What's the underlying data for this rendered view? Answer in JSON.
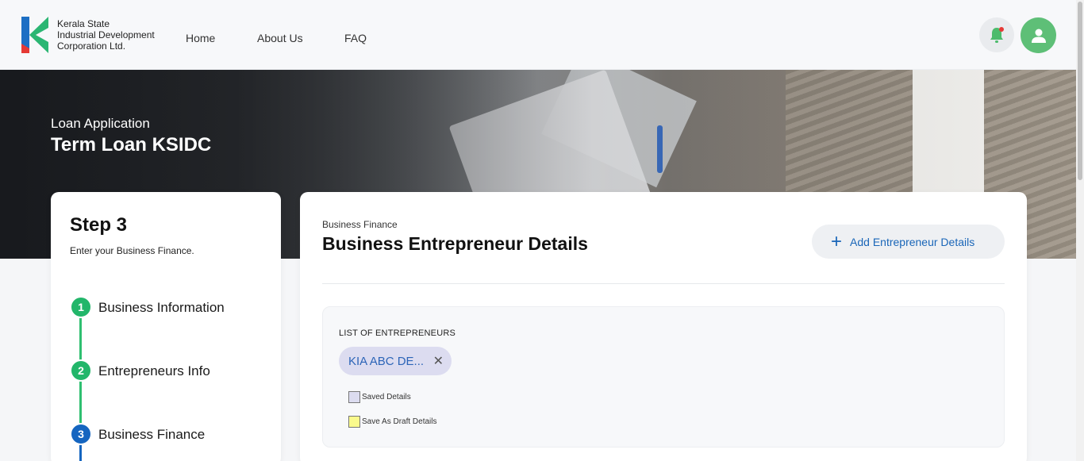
{
  "header": {
    "logo_text": [
      "Kerala State",
      "Industrial Development",
      "Corporation Ltd."
    ],
    "nav": [
      "Home",
      "About Us",
      "FAQ"
    ],
    "notification_icon": "bell-icon",
    "notification_dot_color": "#e53935",
    "profile_icon": "user-icon"
  },
  "hero": {
    "subtitle": "Loan Application",
    "title": "Term Loan KSIDC"
  },
  "steps": {
    "title": "Step 3",
    "description": "Enter your Business Finance.",
    "items": [
      {
        "number": "1",
        "label": "Business Information",
        "status": "complete"
      },
      {
        "number": "2",
        "label": "Entrepreneurs Info",
        "status": "complete"
      },
      {
        "number": "3",
        "label": "Business Finance",
        "status": "current"
      }
    ]
  },
  "main": {
    "kicker": "Business Finance",
    "title": "Business Entrepreneur Details",
    "add_button": "Add Entrepreneur Details",
    "list": {
      "heading": "LIST OF ENTREPRENEURS",
      "chips": [
        "KIA ABC DE..."
      ],
      "legend": [
        {
          "label": "Saved Details",
          "color": "#dcdcf0"
        },
        {
          "label": "Save As Draft Details",
          "color": "#fafa8c"
        }
      ]
    }
  },
  "colors": {
    "accent_green": "#22b66a",
    "accent_blue": "#1565c0",
    "link_blue": "#1a66b8"
  }
}
